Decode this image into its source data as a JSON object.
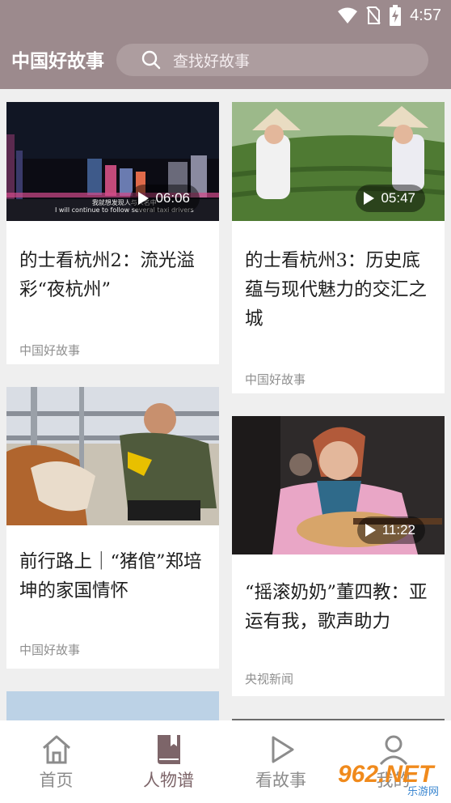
{
  "status_bar": {
    "time": "4:57"
  },
  "header": {
    "brand": "中国好故事",
    "search_placeholder": "查找好故事"
  },
  "cards": [
    {
      "title": "的士看杭州2：流光溢彩“夜杭州”",
      "source": "中国好故事",
      "duration": "06:06",
      "caption_line1": "我就想发现人与人名中",
      "caption_line2": "I will continue to follow several taxi drivers"
    },
    {
      "title": "的士看杭州3：历史底蕴与现代魅力的交汇之城",
      "source": "中国好故事",
      "duration": "05:47"
    },
    {
      "title": "前行路上｜“猪倌”郑培坤的家国情怀",
      "source": "中国好故事"
    },
    {
      "title": "“摇滚奶奶”董四教：亚运有我，歌声助力",
      "source": "央视新闻",
      "duration": "11:22"
    }
  ],
  "tabs": [
    {
      "label": "首页",
      "icon": "home-icon"
    },
    {
      "label": "人物谱",
      "icon": "book-icon",
      "active": true
    },
    {
      "label": "看故事",
      "icon": "play-icon"
    },
    {
      "label": "我的",
      "icon": "user-icon"
    }
  ],
  "watermark": {
    "text": "962.NET",
    "subtext": "乐游网"
  },
  "colors": {
    "header": "#9c8a8d",
    "search": "#ad9d9f",
    "active_tab": "#7d6569",
    "inactive_tab": "#8c8c8c"
  }
}
